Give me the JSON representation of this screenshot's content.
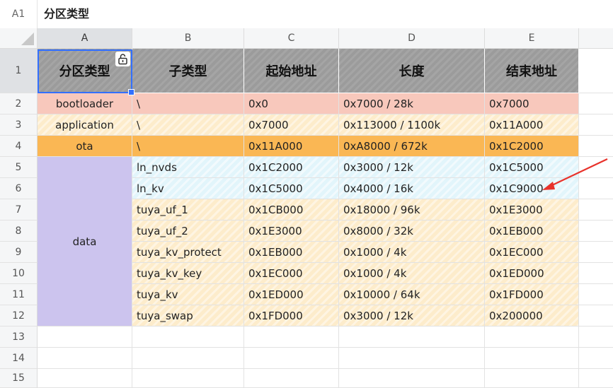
{
  "formula_bar": {
    "cell_ref": "A1",
    "value": "分区类型"
  },
  "columns": [
    "A",
    "B",
    "C",
    "D",
    "E"
  ],
  "rows": [
    "1",
    "2",
    "3",
    "4",
    "5",
    "6",
    "7",
    "8",
    "9",
    "10",
    "11",
    "12",
    "13",
    "14",
    "15"
  ],
  "header": [
    "分区类型",
    "子类型",
    "起始地址",
    "长度",
    "结束地址"
  ],
  "partitions": {
    "bootloader": {
      "type": "bootloader",
      "sub": "\\",
      "start": "0x0",
      "len": "0x7000 / 28k",
      "end": "0x7000"
    },
    "application": {
      "type": "application",
      "sub": "\\",
      "start": "0x7000",
      "len": "0x113000 / 1100k",
      "end": "0x11A000"
    },
    "ota": {
      "type": "ota",
      "sub": "\\",
      "start": "0x11A000",
      "len": "0xA8000 / 672k",
      "end": "0x1C2000"
    }
  },
  "data_group": {
    "type": "data"
  },
  "data_rows": [
    {
      "sub": "ln_nvds",
      "start": "0x1C2000",
      "len": "0x3000 / 12k",
      "end": "0x1C5000"
    },
    {
      "sub": "ln_kv",
      "start": "0x1C5000",
      "len": "0x4000 / 16k",
      "end": "0x1C9000"
    },
    {
      "sub": "tuya_uf_1",
      "start": "0x1CB000",
      "len": "0x18000 / 96k",
      "end": "0x1E3000"
    },
    {
      "sub": "tuya_uf_2",
      "start": "0x1E3000",
      "len": "0x8000 / 32k",
      "end": "0x1EB000"
    },
    {
      "sub": "tuya_kv_protect",
      "start": "0x1EB000",
      "len": "0x1000 / 4k",
      "end": "0x1EC000"
    },
    {
      "sub": "tuya_kv_key",
      "start": "0x1EC000",
      "len": "0x1000 / 4k",
      "end": "0x1ED000"
    },
    {
      "sub": "tuya_kv",
      "start": "0x1ED000",
      "len": "0x10000 / 64k",
      "end": "0x1FD000"
    },
    {
      "sub": "tuya_swap",
      "start": "0x1FD000",
      "len": "0x3000 / 12k",
      "end": "0x200000"
    }
  ],
  "colors": {
    "header": "#9b9b9b",
    "bootloader": "#f8c8bc",
    "application": "#fdeccb",
    "ota": "#fab754",
    "data_cyan": "#e2f5fb",
    "data_yellow": "#fdeccb",
    "data_type": "#ccc4ee",
    "selection": "#3370ff",
    "arrow": "#e8322b"
  },
  "icons": {
    "lock": "unlock-icon",
    "arrow": "red-arrow-annotation"
  }
}
